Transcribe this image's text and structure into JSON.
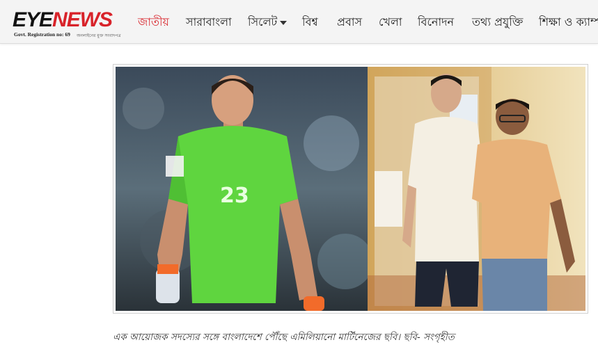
{
  "site": {
    "logo_eye": "EYE",
    "logo_news": "NEWS",
    "registration": "Govt. Registration no: 69",
    "tagline": "অনলাইনের মুক্ত সংবাদপত্র"
  },
  "nav": {
    "items": [
      {
        "label": "জাতীয়",
        "active": true
      },
      {
        "label": "সারাবাংলা",
        "active": false
      },
      {
        "label": "সিলেট",
        "active": false,
        "dropdown": true
      },
      {
        "label": "বিশ্ব",
        "active": false
      },
      {
        "label": "প্রবাস",
        "active": false
      },
      {
        "label": "খেলা",
        "active": false
      },
      {
        "label": "বিনোদন",
        "active": false
      },
      {
        "label": "তথ্য প্রযুক্তি",
        "active": false
      },
      {
        "label": "শিক্ষা ও ক্যাম্পাস",
        "active": false
      }
    ]
  },
  "article": {
    "caption": "এক আয়োজক সদস্যের সঙ্গে বাংলাদেশে পৌঁছে এমিলিয়ানো মার্টিনেজের ছবি। ছবি- সংগৃহীত",
    "jersey_number": "23"
  },
  "colors": {
    "accent": "#d8232a",
    "jersey_green": "#5fd53f",
    "nav_bg": "#f4f4f4"
  }
}
